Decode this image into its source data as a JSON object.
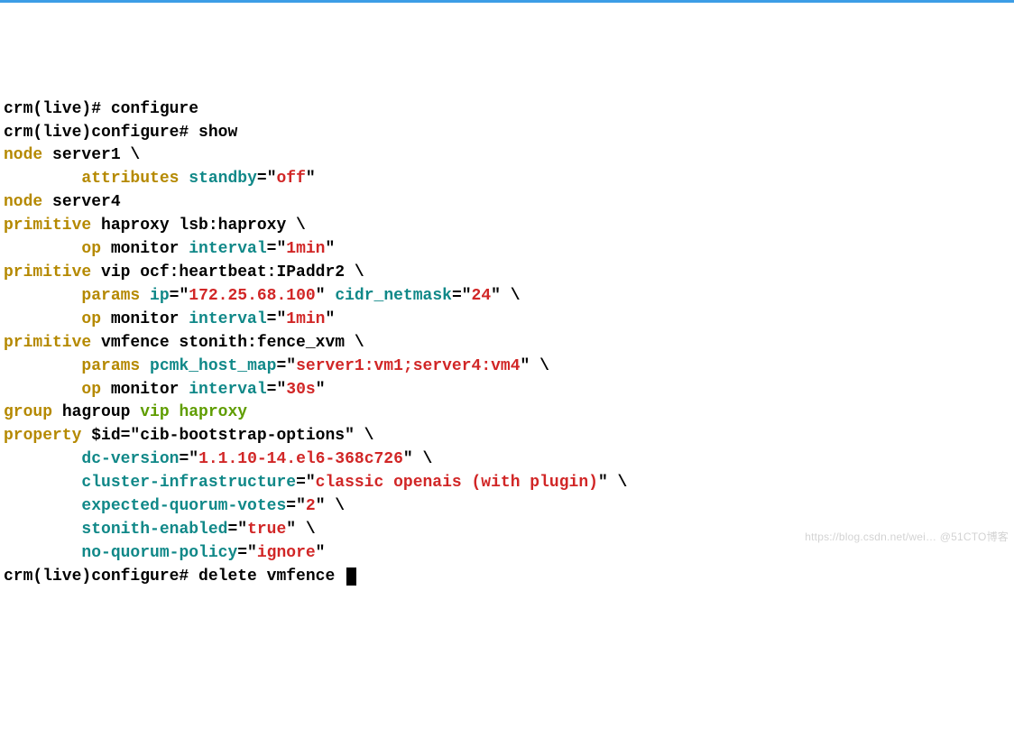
{
  "lines": [
    {
      "segments": [
        {
          "text": "crm(live)# configure",
          "cls": "cr-black"
        }
      ]
    },
    {
      "segments": [
        {
          "text": "crm(live)configure# show",
          "cls": "cr-black"
        }
      ]
    },
    {
      "segments": [
        {
          "text": "node",
          "cls": "cr-olive"
        },
        {
          "text": " server1 \\",
          "cls": "cr-black"
        }
      ]
    },
    {
      "segments": [
        {
          "text": "        ",
          "cls": "cr-black"
        },
        {
          "text": "attributes",
          "cls": "cr-olive"
        },
        {
          "text": " ",
          "cls": "cr-black"
        },
        {
          "text": "standby",
          "cls": "cr-teal"
        },
        {
          "text": "=\"",
          "cls": "cr-black"
        },
        {
          "text": "off",
          "cls": "cr-red"
        },
        {
          "text": "\"",
          "cls": "cr-black"
        }
      ]
    },
    {
      "segments": [
        {
          "text": "node",
          "cls": "cr-olive"
        },
        {
          "text": " server4",
          "cls": "cr-black"
        }
      ]
    },
    {
      "segments": [
        {
          "text": "primitive",
          "cls": "cr-olive"
        },
        {
          "text": " haproxy lsb:haproxy \\",
          "cls": "cr-black"
        }
      ]
    },
    {
      "segments": [
        {
          "text": "        ",
          "cls": "cr-black"
        },
        {
          "text": "op",
          "cls": "cr-olive"
        },
        {
          "text": " monitor ",
          "cls": "cr-black"
        },
        {
          "text": "interval",
          "cls": "cr-teal"
        },
        {
          "text": "=\"",
          "cls": "cr-black"
        },
        {
          "text": "1min",
          "cls": "cr-red"
        },
        {
          "text": "\"",
          "cls": "cr-black"
        }
      ]
    },
    {
      "segments": [
        {
          "text": "primitive",
          "cls": "cr-olive"
        },
        {
          "text": " vip ocf:heartbeat:IPaddr2 \\",
          "cls": "cr-black"
        }
      ]
    },
    {
      "segments": [
        {
          "text": "        ",
          "cls": "cr-black"
        },
        {
          "text": "params",
          "cls": "cr-olive"
        },
        {
          "text": " ",
          "cls": "cr-black"
        },
        {
          "text": "ip",
          "cls": "cr-teal"
        },
        {
          "text": "=\"",
          "cls": "cr-black"
        },
        {
          "text": "172.25.68.100",
          "cls": "cr-red"
        },
        {
          "text": "\" ",
          "cls": "cr-black"
        },
        {
          "text": "cidr_netmask",
          "cls": "cr-teal"
        },
        {
          "text": "=\"",
          "cls": "cr-black"
        },
        {
          "text": "24",
          "cls": "cr-red"
        },
        {
          "text": "\" \\",
          "cls": "cr-black"
        }
      ]
    },
    {
      "segments": [
        {
          "text": "        ",
          "cls": "cr-black"
        },
        {
          "text": "op",
          "cls": "cr-olive"
        },
        {
          "text": " monitor ",
          "cls": "cr-black"
        },
        {
          "text": "interval",
          "cls": "cr-teal"
        },
        {
          "text": "=\"",
          "cls": "cr-black"
        },
        {
          "text": "1min",
          "cls": "cr-red"
        },
        {
          "text": "\"",
          "cls": "cr-black"
        }
      ]
    },
    {
      "segments": [
        {
          "text": "primitive",
          "cls": "cr-olive"
        },
        {
          "text": " vmfence stonith:fence_xvm \\",
          "cls": "cr-black"
        }
      ]
    },
    {
      "segments": [
        {
          "text": "        ",
          "cls": "cr-black"
        },
        {
          "text": "params",
          "cls": "cr-olive"
        },
        {
          "text": " ",
          "cls": "cr-black"
        },
        {
          "text": "pcmk_host_map",
          "cls": "cr-teal"
        },
        {
          "text": "=\"",
          "cls": "cr-black"
        },
        {
          "text": "server1:vm1;server4:vm4",
          "cls": "cr-red"
        },
        {
          "text": "\" \\",
          "cls": "cr-black"
        }
      ]
    },
    {
      "segments": [
        {
          "text": "        ",
          "cls": "cr-black"
        },
        {
          "text": "op",
          "cls": "cr-olive"
        },
        {
          "text": " monitor ",
          "cls": "cr-black"
        },
        {
          "text": "interval",
          "cls": "cr-teal"
        },
        {
          "text": "=\"",
          "cls": "cr-black"
        },
        {
          "text": "30s",
          "cls": "cr-red"
        },
        {
          "text": "\"",
          "cls": "cr-black"
        }
      ]
    },
    {
      "segments": [
        {
          "text": "group",
          "cls": "cr-olive"
        },
        {
          "text": " hagroup ",
          "cls": "cr-black"
        },
        {
          "text": "vip",
          "cls": "cr-green"
        },
        {
          "text": " ",
          "cls": "cr-black"
        },
        {
          "text": "haproxy",
          "cls": "cr-green"
        }
      ]
    },
    {
      "segments": [
        {
          "text": "property",
          "cls": "cr-olive"
        },
        {
          "text": " $id=\"cib-bootstrap-options\" \\",
          "cls": "cr-black"
        }
      ]
    },
    {
      "segments": [
        {
          "text": "        ",
          "cls": "cr-black"
        },
        {
          "text": "dc-version",
          "cls": "cr-teal"
        },
        {
          "text": "=\"",
          "cls": "cr-black"
        },
        {
          "text": "1.1.10-14.el6-368c726",
          "cls": "cr-red"
        },
        {
          "text": "\" \\",
          "cls": "cr-black"
        }
      ]
    },
    {
      "segments": [
        {
          "text": "        ",
          "cls": "cr-black"
        },
        {
          "text": "cluster-infrastructure",
          "cls": "cr-teal"
        },
        {
          "text": "=\"",
          "cls": "cr-black"
        },
        {
          "text": "classic openais (with plugin)",
          "cls": "cr-red"
        },
        {
          "text": "\" \\",
          "cls": "cr-black"
        }
      ]
    },
    {
      "segments": [
        {
          "text": "        ",
          "cls": "cr-black"
        },
        {
          "text": "expected-quorum-votes",
          "cls": "cr-teal"
        },
        {
          "text": "=\"",
          "cls": "cr-black"
        },
        {
          "text": "2",
          "cls": "cr-red"
        },
        {
          "text": "\" \\",
          "cls": "cr-black"
        }
      ]
    },
    {
      "segments": [
        {
          "text": "        ",
          "cls": "cr-black"
        },
        {
          "text": "stonith-enabled",
          "cls": "cr-teal"
        },
        {
          "text": "=\"",
          "cls": "cr-black"
        },
        {
          "text": "true",
          "cls": "cr-red"
        },
        {
          "text": "\" \\",
          "cls": "cr-black"
        }
      ]
    },
    {
      "segments": [
        {
          "text": "        ",
          "cls": "cr-black"
        },
        {
          "text": "no-quorum-policy",
          "cls": "cr-teal"
        },
        {
          "text": "=\"",
          "cls": "cr-black"
        },
        {
          "text": "ignore",
          "cls": "cr-red"
        },
        {
          "text": "\"",
          "cls": "cr-black"
        }
      ]
    },
    {
      "segments": [
        {
          "text": "crm(live)configure# delete vmfence ",
          "cls": "cr-black"
        }
      ],
      "cursor": true
    }
  ],
  "watermark": "https://blog.csdn.net/wei… @51CTO博客"
}
